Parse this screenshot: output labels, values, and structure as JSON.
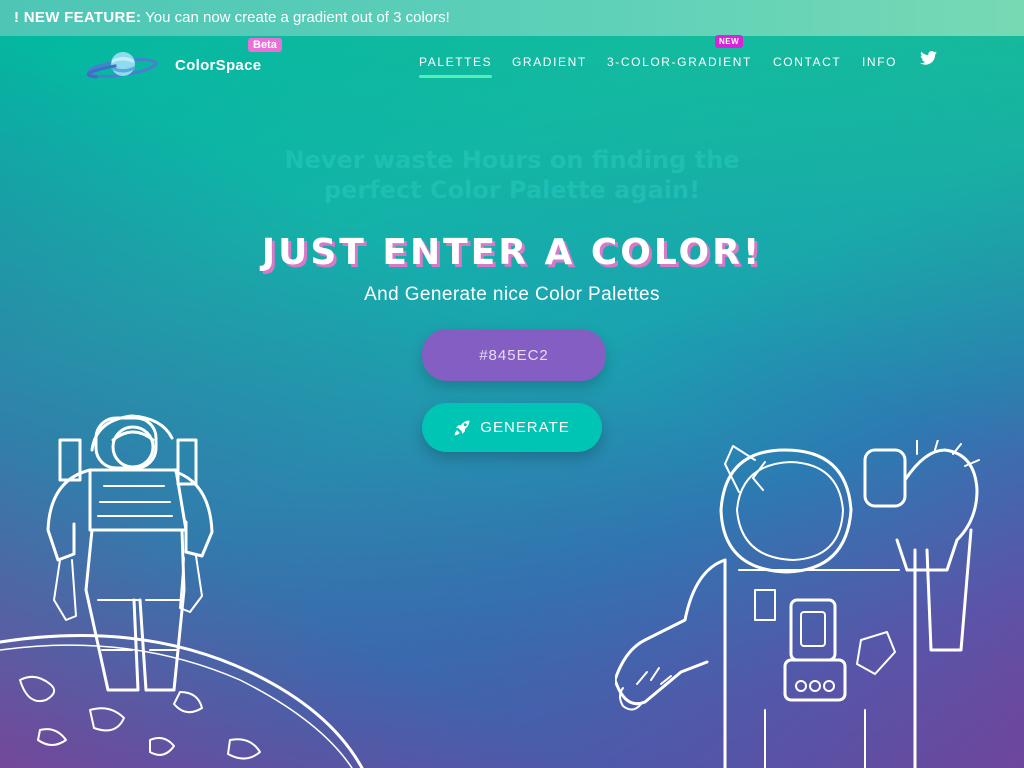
{
  "banner": {
    "tag": "! NEW FEATURE:",
    "text": " You can now create a gradient out of 3 colors!"
  },
  "brand": {
    "name": "ColorSpace",
    "badge": "Beta"
  },
  "nav": {
    "items": [
      {
        "label": "PALETTES",
        "active": true
      },
      {
        "label": "GRADIENT"
      },
      {
        "label": "3-COLOR-GRADIENT"
      },
      {
        "label": "CONTACT"
      },
      {
        "label": "INFO"
      }
    ],
    "new_badge": "NEW",
    "twitter_icon": "twitter-icon"
  },
  "hero": {
    "tagline_line1": "Never waste Hours on finding the",
    "tagline_line2": "perfect Color Palette again!",
    "headline": "JUST ENTER A COLOR!",
    "subline": "And Generate nice Color Palettes"
  },
  "form": {
    "color_value": "#845EC2",
    "generate_label": "GENERATE",
    "generate_icon": "rocket-icon"
  },
  "colors": {
    "input_bg": "#845EC2",
    "button_bg": "#00C4B4",
    "beta_badge": "#EA6FD6",
    "new_badge": "#D624D8",
    "active_underline": "#57F0B4"
  }
}
